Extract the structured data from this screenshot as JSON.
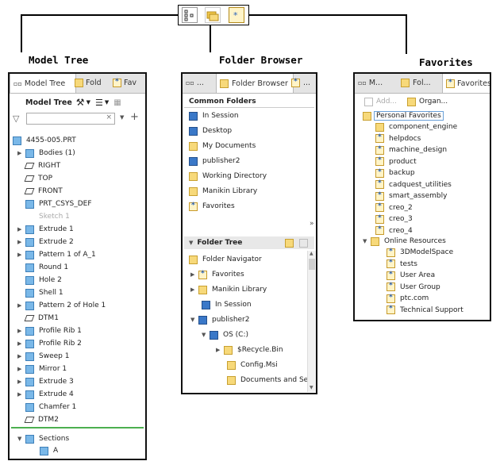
{
  "headings": {
    "model_tree": "Model Tree",
    "folder_browser": "Folder Browser",
    "favorites": "Favorites"
  },
  "model_tree": {
    "tab1": "Model Tree",
    "tab2": "Fold",
    "tab3": "Fav",
    "toolbar_label": "Model Tree",
    "items": [
      "4455-005.PRT",
      "Bodies (1)",
      "RIGHT",
      "TOP",
      "FRONT",
      "PRT_CSYS_DEF",
      "Sketch 1",
      "Extrude 1",
      "Extrude 2",
      "Pattern 1 of A_1",
      "Round 1",
      "Hole 2",
      "Shell 1",
      "Pattern 2 of Hole 1",
      "DTM1",
      "Profile Rib 1",
      "Profile Rib 2",
      "Sweep 1",
      "Mirror 1",
      "Extrude 3",
      "Extrude 4",
      "Chamfer 1",
      "DTM2"
    ],
    "sections": "Sections",
    "section_child": "A"
  },
  "folder_browser": {
    "tab1": "...",
    "tab2": "Folder Browser",
    "tab3": "...",
    "common_header": "Common Folders",
    "common": [
      "In Session",
      "Desktop",
      "My Documents",
      "publisher2",
      "Working Directory",
      "Manikin Library",
      "Favorites"
    ],
    "tree_header": "Folder Tree",
    "tree": [
      "Folder Navigator",
      "Favorites",
      "Manikin Library",
      "In Session",
      "publisher2",
      "OS (C:)",
      "$Recycle.Bin",
      "Config.Msi",
      "Documents and Se"
    ]
  },
  "favorites": {
    "tab1": "M...",
    "tab2": "Fol...",
    "tab3": "Favorites",
    "add": "Add...",
    "organize": "Organ...",
    "root": "Personal Favorites",
    "items": [
      "component_engine",
      "helpdocs",
      "machine_design",
      "product",
      "backup",
      "cadquest_utilities",
      "smart_assembly",
      "creo_2",
      "creo_3",
      "creo_4"
    ],
    "online": "Online Resources",
    "online_items": [
      "3DModelSpace",
      "tests",
      "User Area",
      "User Group",
      "ptc.com",
      "Technical Support"
    ]
  }
}
